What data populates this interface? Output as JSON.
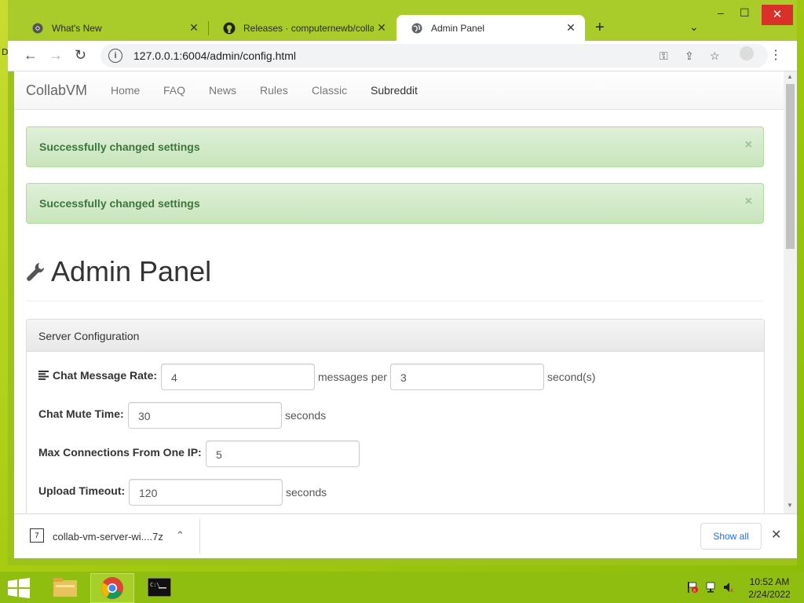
{
  "desktop_label": "D",
  "browser": {
    "tabs": [
      {
        "label": "What's New",
        "close": "✕"
      },
      {
        "label": "Releases · computernewb/collab",
        "close": "✕"
      },
      {
        "label": "Admin Panel",
        "close": "✕"
      }
    ],
    "new_tab": "+",
    "tab_list": "⌄",
    "window_controls": {
      "minimize": "–",
      "maximize": "☐",
      "close": "✕"
    },
    "url": "127.0.0.1:6004/admin/config.html"
  },
  "page": {
    "brand": "CollabVM",
    "nav": [
      "Home",
      "FAQ",
      "News",
      "Rules",
      "Classic",
      "Subreddit"
    ],
    "alerts": [
      {
        "message": "Successfully changed settings",
        "close": "×"
      },
      {
        "message": "Successfully changed settings",
        "close": "×"
      }
    ],
    "title": "Admin Panel",
    "panel_heading": "Server Configuration",
    "fields": {
      "chat_rate": {
        "label": "Chat Message Rate:",
        "value": "4",
        "mid": "messages per",
        "value2": "3",
        "suffix": "second(s)"
      },
      "mute_time": {
        "label": "Chat Mute Time:",
        "value": "30",
        "suffix": "seconds"
      },
      "max_conn": {
        "label": "Max Connections From One IP:",
        "value": "5"
      },
      "upload_timeout": {
        "label": "Upload Timeout:",
        "value": "120",
        "suffix": "seconds"
      }
    }
  },
  "download_bar": {
    "file": "collab-vm-server-wi....7z",
    "show_all": "Show all",
    "close": "✕"
  },
  "taskbar": {
    "time": "10:52 AM",
    "date": "2/24/2022"
  },
  "colors": {
    "accent_green": "#3c763d",
    "desktop": "#9dc21a",
    "link_blue": "#1a73e8"
  }
}
